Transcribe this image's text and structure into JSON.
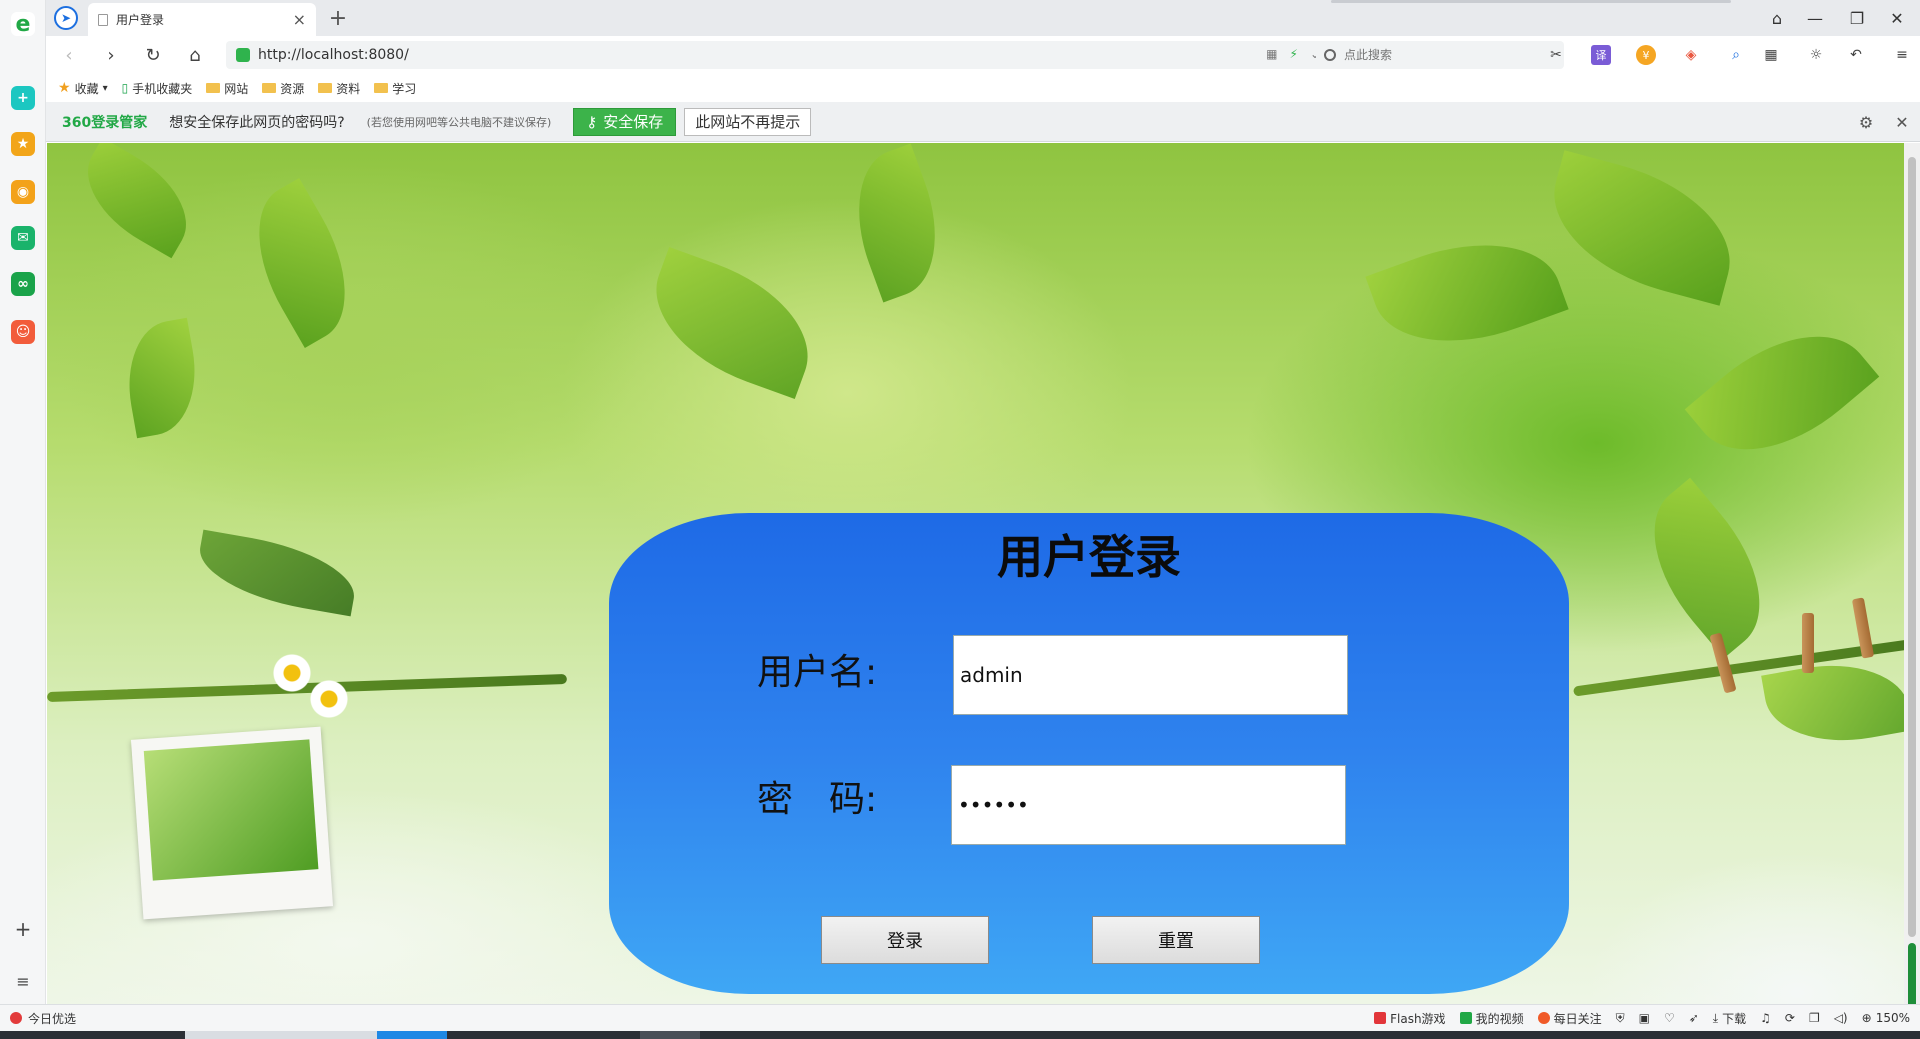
{
  "browser": {
    "tab_title": "用户登录",
    "url": "http://localhost:8080/",
    "search_placeholder": "点此搜索",
    "bookmarks": [
      {
        "label": "收藏",
        "icon": "star-icon"
      },
      {
        "label": "手机收藏夹",
        "icon": "phone-icon"
      },
      {
        "label": "网站",
        "icon": "folder-icon"
      },
      {
        "label": "资源",
        "icon": "folder-icon"
      },
      {
        "label": "资料",
        "icon": "folder-icon"
      },
      {
        "label": "学习",
        "icon": "folder-icon"
      }
    ]
  },
  "password_bar": {
    "logo": "360登录管家",
    "question": "想安全保存此网页的密码吗?",
    "hint": "(若您使用网吧等公共电脑不建议保存)",
    "save_label": "安全保存",
    "never_label": "此网站不再提示"
  },
  "login": {
    "title": "用户登录",
    "username_label": "用户名:",
    "username_value": "admin",
    "password_label": "密　码:",
    "password_value": "••••••",
    "submit_label": "登录",
    "reset_label": "重置"
  },
  "status_bar": {
    "left": "今日优选",
    "flash": "Flash游戏",
    "video": "我的视频",
    "follow": "每日关注",
    "download": "下载",
    "zoom": "150%"
  },
  "colors": {
    "card_top": "#1e6ae6",
    "card_bottom": "#3fa7f5",
    "save_green": "#3cb34a"
  }
}
